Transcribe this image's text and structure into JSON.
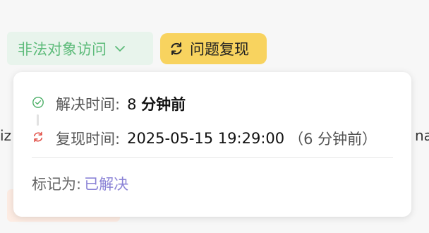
{
  "tags": {
    "issue_label": "非法对象访问",
    "repro_label": "问题复现"
  },
  "background": {
    "left_fragment": "iz",
    "right_fragment": "na"
  },
  "popover": {
    "resolved_time_label": "解决时间:",
    "resolved_time_value_num": "8",
    "resolved_time_value_unit": "分钟前",
    "repro_time_label": "复现时间:",
    "repro_time_value": "2025-05-15 19:29:00",
    "repro_time_relative": "（6 分钟前）",
    "mark_as_label": "标记为:",
    "mark_as_value": "已解决"
  },
  "colors": {
    "issue_tag_bg": "#e8f4ec",
    "issue_tag_text": "#5dbb7a",
    "repro_tag_bg": "#f8d35f",
    "resolved_icon": "#4caf67",
    "repro_icon": "#e0483f",
    "resolved_link": "#8a82d6"
  },
  "icons": {
    "chevron": "chevron-down-icon",
    "refresh": "refresh-icon",
    "check": "check-circle-icon",
    "repro": "refresh-icon"
  }
}
